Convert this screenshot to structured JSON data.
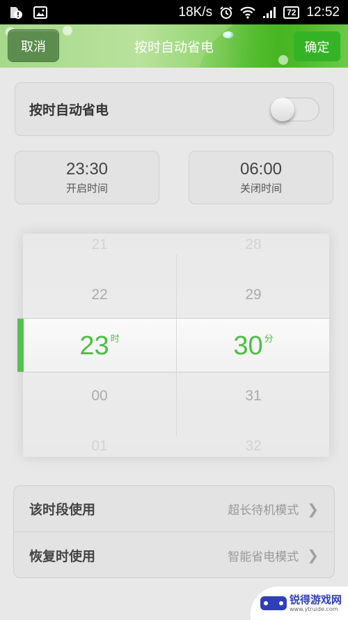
{
  "status_bar": {
    "network_speed": "18K/s",
    "battery": "72",
    "time": "12:52",
    "icons": [
      "sd-card-alert-icon",
      "image-icon",
      "alarm-icon",
      "wifi-icon",
      "signal-icon",
      "battery-icon"
    ]
  },
  "header": {
    "cancel_label": "取消",
    "title": "按时自动省电",
    "confirm_label": "确定"
  },
  "toggle": {
    "label": "按时自动省电",
    "enabled": false
  },
  "times": {
    "start": {
      "value": "23:30",
      "label": "开启时间"
    },
    "end": {
      "value": "06:00",
      "label": "关闭时间"
    }
  },
  "picker": {
    "hours": {
      "items": [
        "21",
        "22",
        "23",
        "00",
        "01"
      ],
      "selected": "23",
      "unit": "时"
    },
    "minutes": {
      "items": [
        "28",
        "29",
        "30",
        "31",
        "32"
      ],
      "selected": "30",
      "unit": "分"
    }
  },
  "settings": [
    {
      "label": "该时段使用",
      "value": "超长待机模式"
    },
    {
      "label": "恢复时使用",
      "value": "智能省电模式"
    }
  ],
  "watermark": {
    "title": "锐得游戏网",
    "url": "www.ytruide.com"
  },
  "colors": {
    "accent_green": "#4cbf43",
    "confirm_button": "#34b326",
    "cancel_button": "#5c8c4e"
  }
}
